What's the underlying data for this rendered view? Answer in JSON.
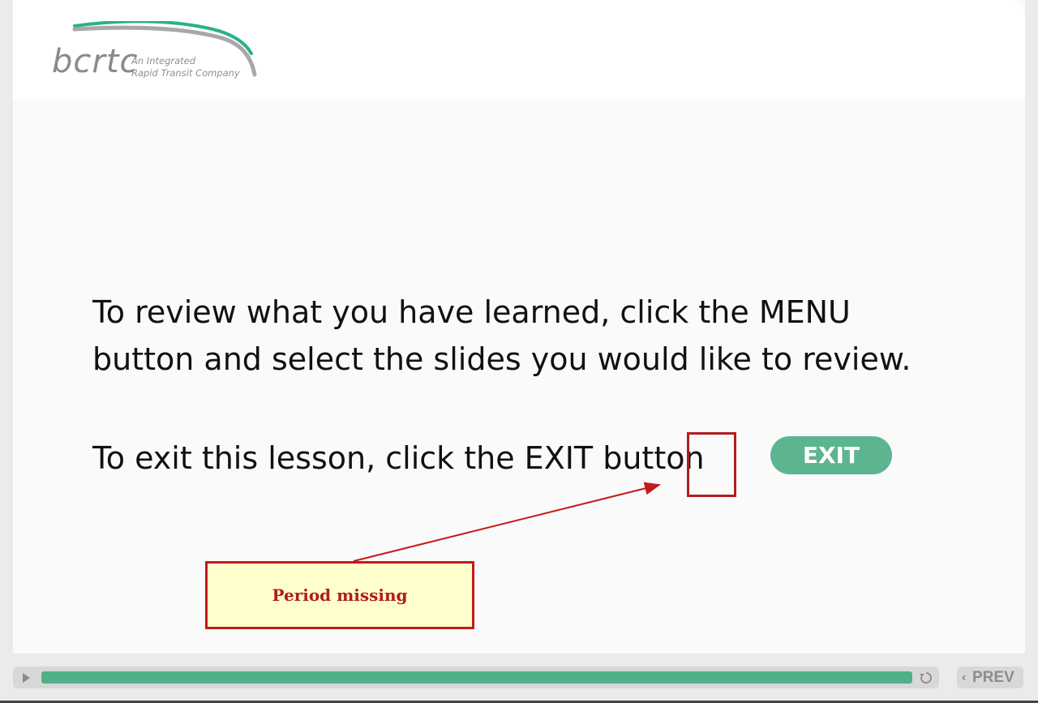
{
  "logo": {
    "wordmark": "bcrtc",
    "tagline_line1": "An Integrated",
    "tagline_line2": "Rapid Transit Company",
    "swoosh_color": "#2ab08c",
    "swoosh_secondary_color": "#a8a8a8"
  },
  "slide": {
    "paragraph1_line1": "To review what you have learned, click the MENU",
    "paragraph1_line2": "button and select the slides you would like to review.",
    "paragraph2": "To exit this lesson, click the EXIT button",
    "exit_button_label": "EXIT",
    "accent_color": "#5db58f"
  },
  "annotation": {
    "callout_text": "Period missing",
    "color": "#b01d1d"
  },
  "player": {
    "play_icon": "play-icon",
    "replay_icon": "replay-icon",
    "progress_percent": 100,
    "prev_label": "PREV",
    "prev_icon": "chevron-left-icon"
  }
}
